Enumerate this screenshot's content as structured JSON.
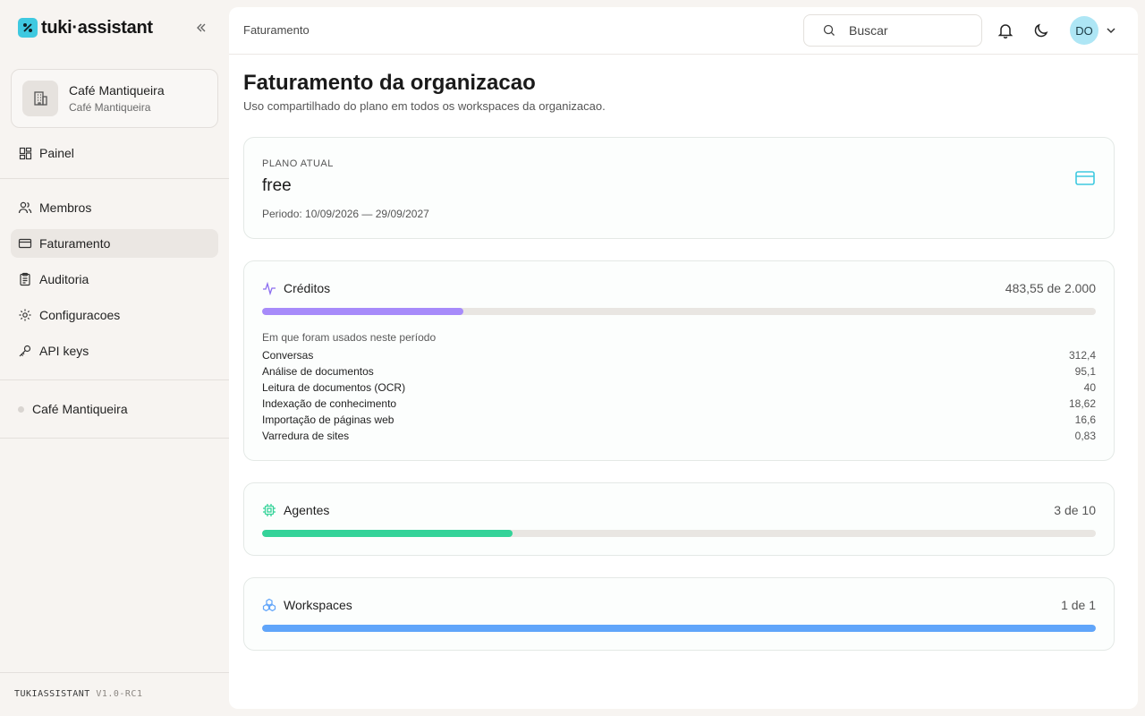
{
  "brand": {
    "name_part1": "tuki",
    "separator": "·",
    "name_part2": "assistant"
  },
  "org": {
    "name": "Café Mantiqueira",
    "subtitle": "Café Mantiqueira"
  },
  "nav": {
    "painel": "Painel",
    "membros": "Membros",
    "faturamento": "Faturamento",
    "auditoria": "Auditoria",
    "configuracoes": "Configuracoes",
    "api_keys": "API keys"
  },
  "workspace": {
    "name": "Café Mantiqueira"
  },
  "footer": {
    "product": "TUKIASSISTANT",
    "version": "V1.0-RC1"
  },
  "topbar": {
    "breadcrumb": "Faturamento",
    "search_placeholder": "Buscar",
    "avatar_initials": "DO"
  },
  "page": {
    "title": "Faturamento da organizacao",
    "subtitle": "Uso compartilhado do plano em todos os workspaces da organizacao."
  },
  "plan": {
    "label": "PLANO ATUAL",
    "name": "free",
    "period": "Periodo: 10/09/2026 — 29/09/2027"
  },
  "credits": {
    "title": "Créditos",
    "count": "483,55 de 2.000",
    "progress": 0.2418,
    "usage_title": "Em que foram usados neste período",
    "usage": [
      {
        "label": "Conversas",
        "value": "312,4"
      },
      {
        "label": "Análise de documentos",
        "value": "95,1"
      },
      {
        "label": "Leitura de documentos (OCR)",
        "value": "40"
      },
      {
        "label": "Indexação de conhecimento",
        "value": "18,62"
      },
      {
        "label": "Importação de páginas web",
        "value": "16,6"
      },
      {
        "label": "Varredura de sites",
        "value": "0,83"
      }
    ]
  },
  "agents": {
    "title": "Agentes",
    "count": "3 de 10",
    "progress": 0.3
  },
  "workspaces": {
    "title": "Workspaces",
    "count": "1 de 1",
    "progress": 1.0
  },
  "colors": {
    "credits_bar": "#a78bfa",
    "agents_bar": "#34d399",
    "workspaces_bar": "#60a5fa",
    "brand_accent": "#3fc9e0"
  }
}
